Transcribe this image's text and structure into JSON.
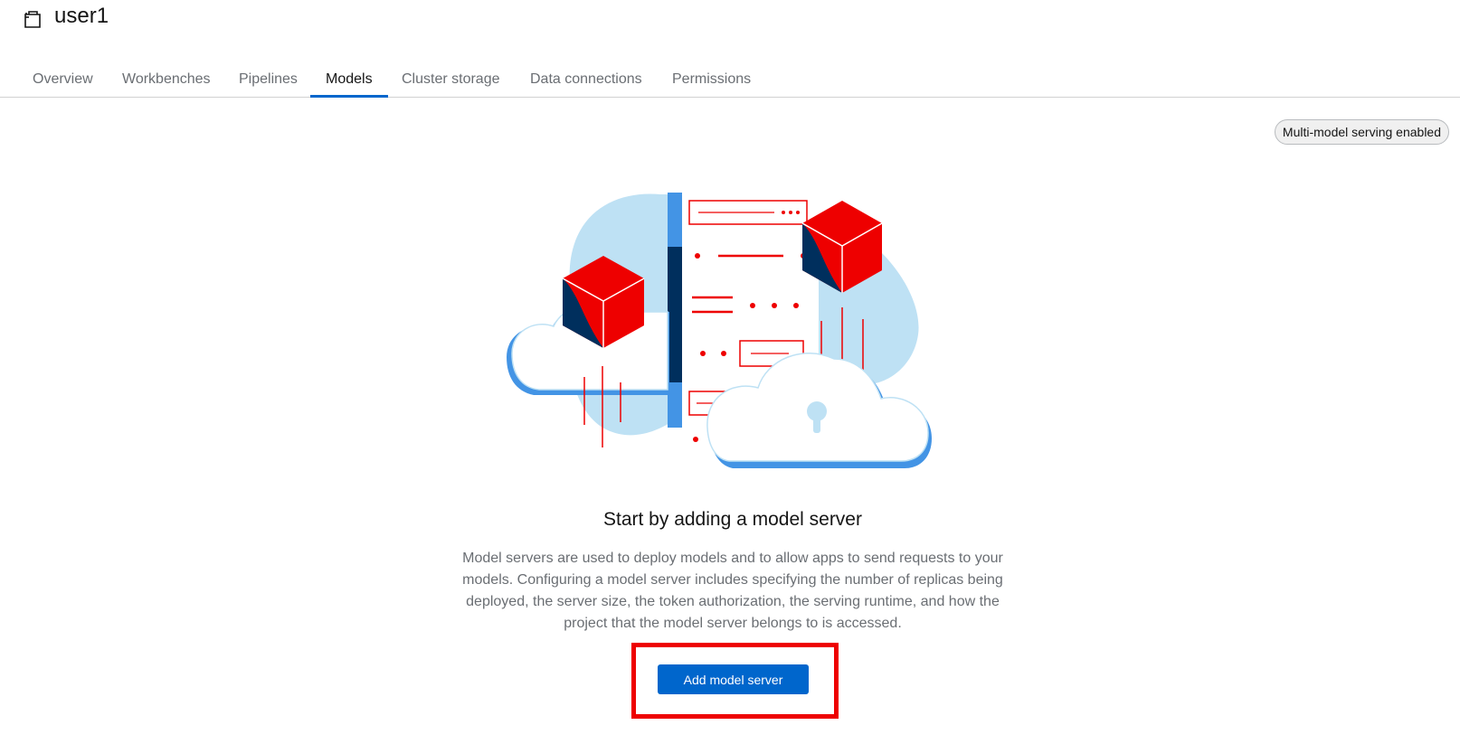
{
  "header": {
    "project_icon": "folder-icon",
    "title": "user1"
  },
  "tabs": [
    {
      "label": "Overview",
      "active": false
    },
    {
      "label": "Workbenches",
      "active": false
    },
    {
      "label": "Pipelines",
      "active": false
    },
    {
      "label": "Models",
      "active": true
    },
    {
      "label": "Cluster storage",
      "active": false
    },
    {
      "label": "Data connections",
      "active": false
    },
    {
      "label": "Permissions",
      "active": false
    }
  ],
  "serving_badge": "Multi-model serving enabled",
  "empty_state": {
    "illustration": "model-server-cloud-illustration",
    "title": "Start by adding a model server",
    "body": "Model servers are used to deploy models and to allow apps to send requests to your models. Configuring a model server includes specifying the number of replicas being deployed, the server size, the token authorization, the serving runtime, and how the project that the model server belongs to is accessed.",
    "button_label": "Add model server"
  },
  "colors": {
    "primary": "#0066cc",
    "highlight": "#ee0000",
    "cube_red": "#ee0000",
    "cube_navy": "#002f5d",
    "cloud_blue": "#bee1f4"
  }
}
